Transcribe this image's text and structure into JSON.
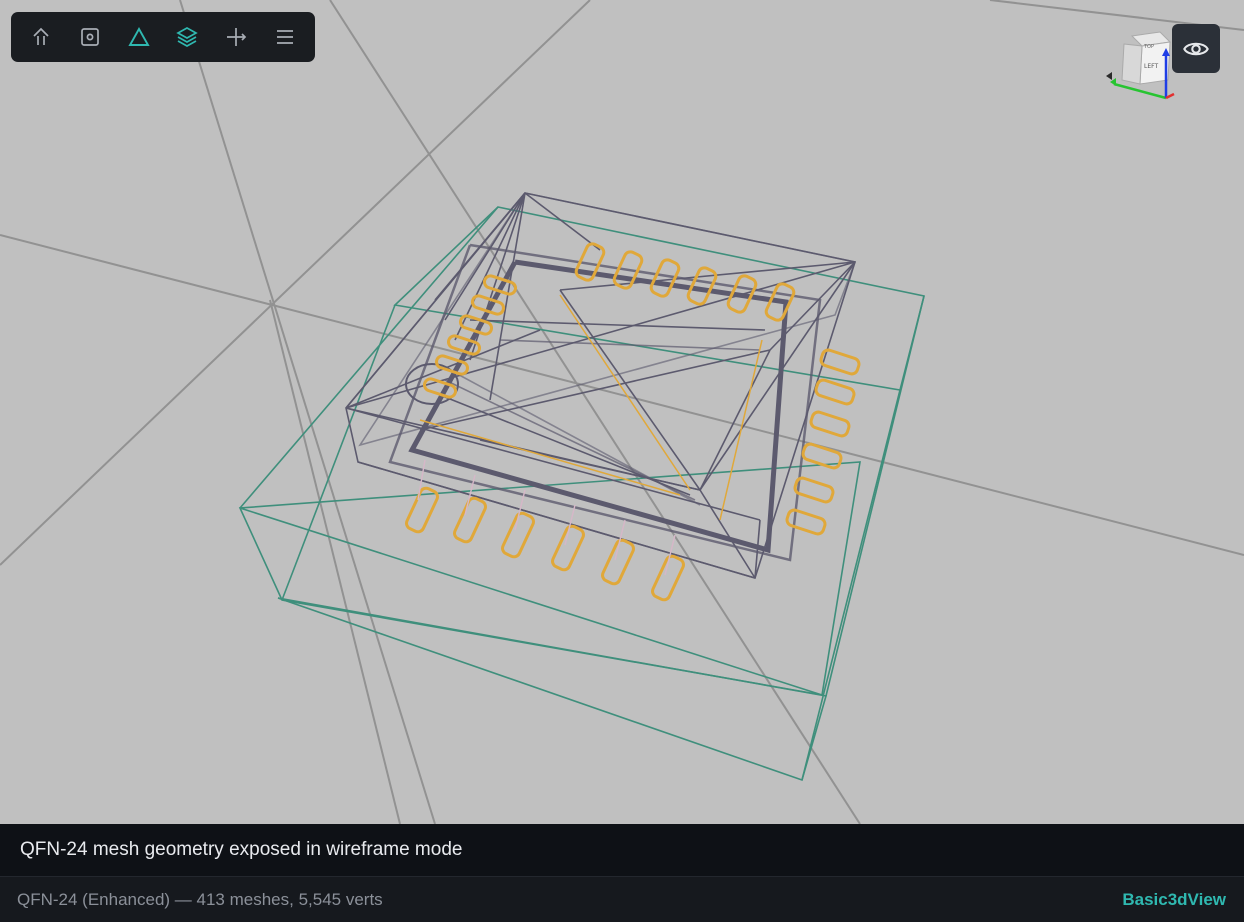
{
  "toolbar": {
    "buttons": [
      {
        "icon": "home-icon",
        "active": false
      },
      {
        "icon": "frame-icon",
        "active": false
      },
      {
        "icon": "wireframe-triangle-icon",
        "active": true
      },
      {
        "icon": "layers-icon",
        "active": true
      },
      {
        "icon": "axis-icon",
        "active": false
      },
      {
        "icon": "menu-icon",
        "active": false
      }
    ]
  },
  "view_cube": {
    "face_label": "LEFT",
    "top_label": "TOP"
  },
  "caption": "QFN-24 mesh geometry exposed in wireframe mode",
  "status": {
    "model_info": "QFN-24 (Enhanced) — 413 meshes, 5,545 verts",
    "brand": "Basic3dView"
  },
  "colors": {
    "viewport_bg": "#c0c0c0",
    "accent": "#2fb8b0",
    "icon_default": "#a8adb5",
    "mesh_body": "#5c5a6e",
    "mesh_pins": "#e0a83a",
    "bounding_box": "#3f8f7c",
    "grid": "#8a8a8a"
  }
}
